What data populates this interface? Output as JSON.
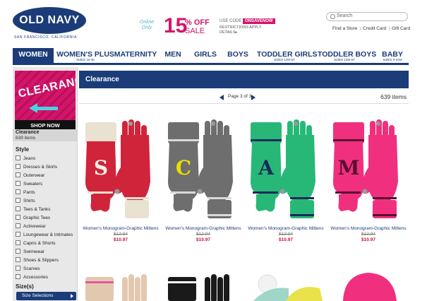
{
  "header": {
    "logo": "OLD NAVY",
    "logo_sub": "SAN FRANCISCO, CALIFORNIA",
    "promo_online": "Online Only",
    "promo_big": "15",
    "promo_pct": "% OFF",
    "promo_sale": "SALE",
    "promo_code_label": "USE CODE",
    "promo_code": "ONSAVENOW",
    "promo_restrictions": "RESTRICTIONS APPLY.",
    "promo_details": "DETAILS▸",
    "search_placeholder": "Search",
    "links": [
      "Find a Store",
      "Credit Card",
      "Gift Card"
    ]
  },
  "nav": [
    {
      "label": "WOMEN",
      "sub": ""
    },
    {
      "label": "WOMEN'S PLUS",
      "sub": "SIZES 16-30"
    },
    {
      "label": "MATERNITY",
      "sub": ""
    },
    {
      "label": "MEN",
      "sub": ""
    },
    {
      "label": "GIRLS",
      "sub": ""
    },
    {
      "label": "BOYS",
      "sub": ""
    },
    {
      "label": "TODDLER GIRLS",
      "sub": "SIZES 12M-5T"
    },
    {
      "label": "TODDLER BOYS",
      "sub": "SIZES 12M-5T"
    },
    {
      "label": "BABY",
      "sub": "SIZES 0-24M"
    }
  ],
  "sidebar": {
    "banner_title": "CLEARANCE",
    "banner_button": "SHOP NOW",
    "category_name": "Clearance",
    "category_count": "639 items",
    "style_title": "Style",
    "style_items": [
      "Jeans",
      "Dresses & Skirts",
      "Outerwear",
      "Sweaters",
      "Pants",
      "Shirts",
      "Tees & Tanks",
      "Graphic Tees",
      "Activewear",
      "Loungewear & Intimates",
      "Capris & Shorts",
      "Swimwear",
      "Shoes & Slippers",
      "Scarves",
      "Accessories"
    ],
    "size_title": "Size(s)",
    "size_button": "Size Selections"
  },
  "main": {
    "title": "Clearance",
    "pagination": "Page 3 of 3",
    "item_count": "639 items",
    "products": [
      {
        "name": "Women's Monogram-Graphic Mittens",
        "old_price": "$12.94",
        "price": "$10.97",
        "color": "#d0243a",
        "cuff": "#e9e2d0",
        "letter": "S",
        "letter_color": "#f4f0e6",
        "stripe": "#e9e2d0"
      },
      {
        "name": "Women's Monogram-Graphic Mittens",
        "old_price": "$12.94",
        "price": "$10.97",
        "color": "#6e6e6e",
        "cuff": "#6e6e6e",
        "letter": "C",
        "letter_color": "#e8e000",
        "stripe": "#d9d9d9"
      },
      {
        "name": "Women's Monogram-Graphic Mittens",
        "old_price": "$12.94",
        "price": "$10.97",
        "color": "#27b878",
        "cuff": "#27b878",
        "letter": "A",
        "letter_color": "#1b2a5a",
        "stripe": "#1b2a5a"
      },
      {
        "name": "Women's Monogram-Graphic Mittens",
        "old_price": "$12.94",
        "price": "$10.97",
        "color": "#f0307f",
        "cuff": "#f0307f",
        "letter": "M",
        "letter_color": "#5a1030",
        "stripe": "#5a1030"
      }
    ],
    "row2_colors": [
      "#e3c8b0",
      "#1a1a1a",
      "#9fd6c8",
      "#f0307f"
    ]
  }
}
